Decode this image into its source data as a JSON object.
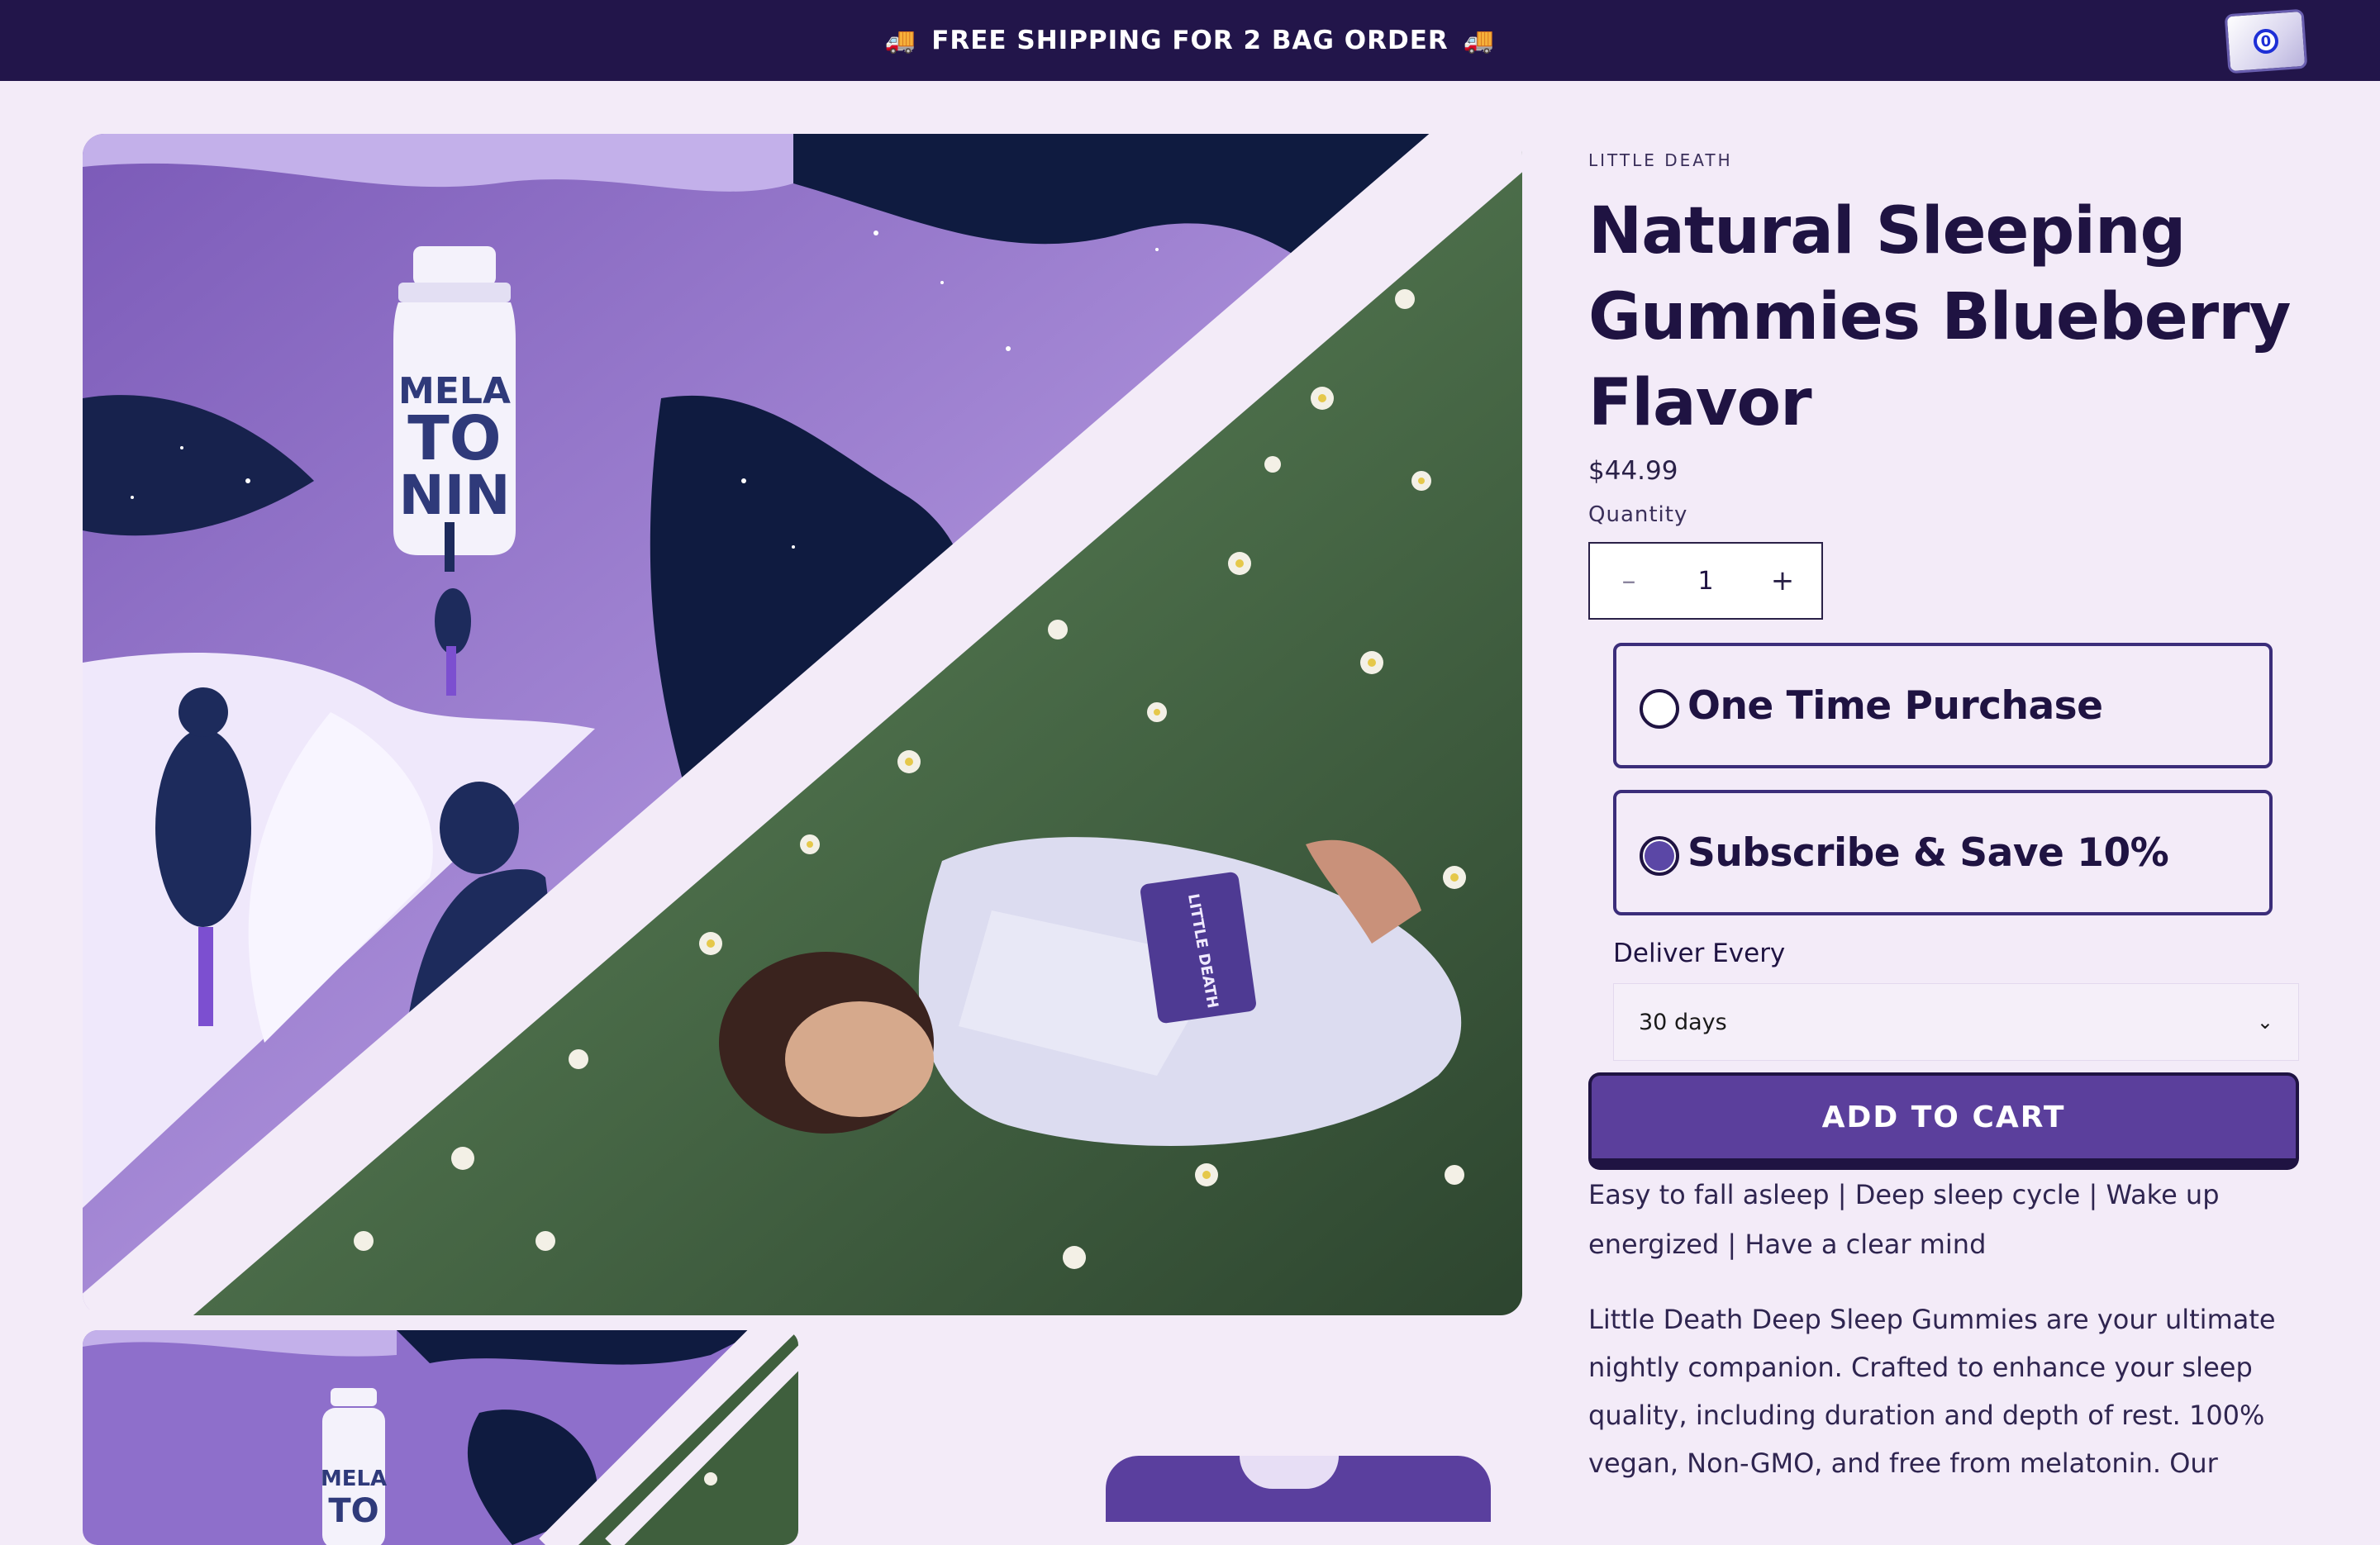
{
  "announcement": {
    "text": "FREE SHIPPING FOR 2 BAG ORDER",
    "icon_left": "🚚",
    "icon_right": "🚚"
  },
  "cart": {
    "count": "0"
  },
  "product_images": {
    "main_label_lines": [
      "MELA",
      "TO",
      "NIN"
    ],
    "thumb_label_lines": [
      "MELA",
      "TO"
    ]
  },
  "product": {
    "vendor": "LITTLE DEATH",
    "title": "Natural Sleeping Gummies Blueberry Flavor",
    "price": "$44.99",
    "quantity_label": "Quantity",
    "quantity_value": "1",
    "decrease_symbol": "–",
    "increase_symbol": "+",
    "purchase_options": [
      {
        "label": "One Time Purchase",
        "selected": false
      },
      {
        "label": "Subscribe & Save 10%",
        "selected": true
      }
    ],
    "deliver_label": "Deliver Every",
    "deliver_selected": "30 days",
    "add_to_cart_label": "ADD TO CART",
    "benefits": "Easy to fall asleep | Deep sleep cycle | Wake up energized | Have a clear mind",
    "description": "Little Death Deep Sleep Gummies are your ultimate nightly companion. Crafted to enhance your sleep quality, including duration and depth of rest. 100% vegan, Non-GMO, and free from melatonin. Our"
  },
  "colors": {
    "page_bg": "#f3ebf8",
    "announcement_bg": "#22154a",
    "brand_purple": "#5b3f9c",
    "ink": "#1f1342"
  }
}
